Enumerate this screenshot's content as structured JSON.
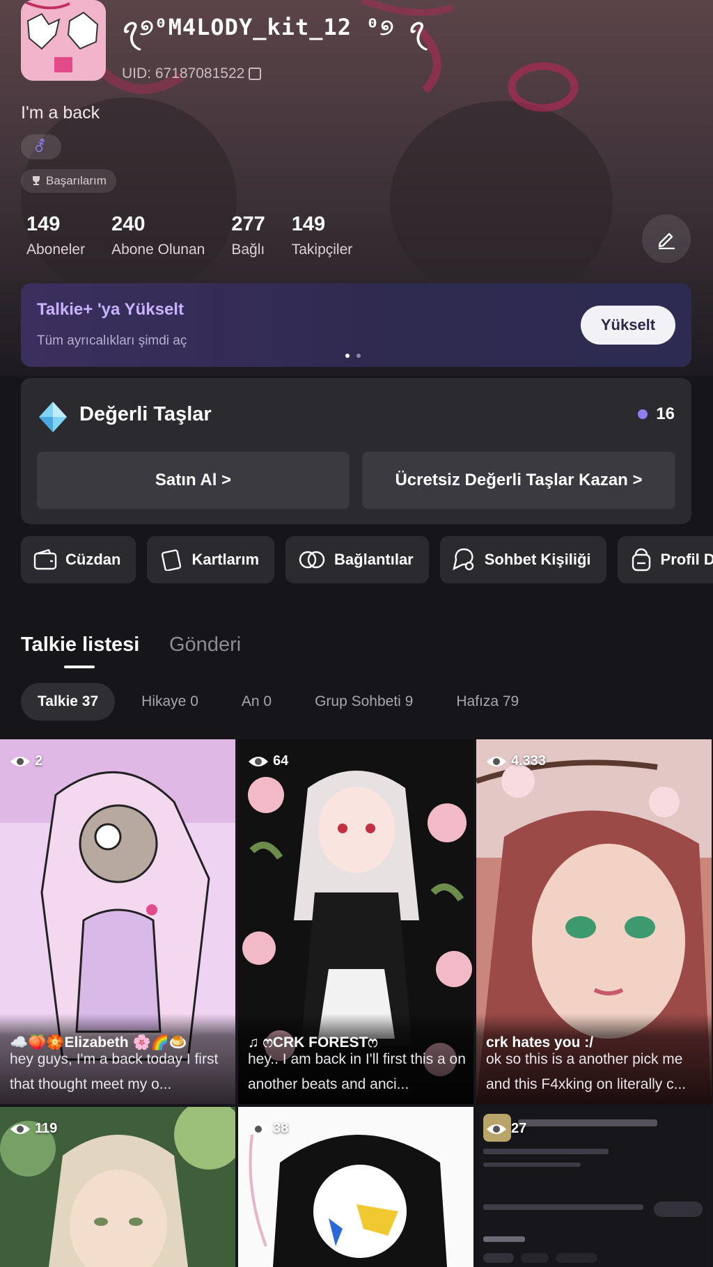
{
  "profile": {
    "username": "ꪖ୭⁰M4LODY_kit_12 ⁰୭ ꪖ",
    "uid": "UID: 67187081522",
    "bio": "I'm a back",
    "gender_symbol": "⚦",
    "achievements_label": "Başarılarım"
  },
  "stats": [
    {
      "value": "149",
      "label": "Aboneler"
    },
    {
      "value": "240",
      "label": "Abone Olunan"
    },
    {
      "value": "277",
      "label": "Bağlı"
    },
    {
      "value": "149",
      "label": "Takipçiler"
    }
  ],
  "premium": {
    "title": "Talkie+ 'ya Yükselt",
    "subtitle": "Tüm ayrıcalıkları şimdi aç",
    "button": "Yükselt"
  },
  "gems": {
    "title": "Değerli Taşlar",
    "count": "16",
    "buy_label": "Satın Al >",
    "earn_label": "Ücretsiz Değerli Taşlar Kazan >"
  },
  "quick_actions": [
    {
      "label": "Cüzdan",
      "icon": "wallet-icon"
    },
    {
      "label": "Kartlarım",
      "icon": "cards-icon"
    },
    {
      "label": "Bağlantılar",
      "icon": "links-icon"
    },
    {
      "label": "Sohbet Kişiliği",
      "icon": "persona-icon"
    },
    {
      "label": "Profil D",
      "icon": "profile-icon"
    }
  ],
  "tabs": {
    "primary": "Talkie listesi",
    "secondary": "Gönderi"
  },
  "subtabs": [
    {
      "label": "Talkie 37",
      "active": true
    },
    {
      "label": "Hikaye 0",
      "active": false
    },
    {
      "label": "An 0",
      "active": false
    },
    {
      "label": "Grup Sohbeti 9",
      "active": false
    },
    {
      "label": "Hafıza 79",
      "active": false
    }
  ],
  "cards": [
    {
      "views": "2",
      "name": "☁️🍑🏵️Elizabeth 🌸🌈🍮",
      "desc": "hey guys, I'm a back today I first that thought meet my o..."
    },
    {
      "views": "64",
      "name": "♫ ෆCRK FORESTෆ",
      "desc": "hey.. I am back in I'll first this a on another beats and anci..."
    },
    {
      "views": "4.333",
      "name": "crk hates you :/",
      "desc": "ok so this is a another pick me and this F4xking on literally c..."
    },
    {
      "views": "119",
      "name": "",
      "desc": ""
    },
    {
      "views": "38",
      "name": "",
      "desc": ""
    },
    {
      "views": "27",
      "name": "",
      "desc": ""
    }
  ]
}
